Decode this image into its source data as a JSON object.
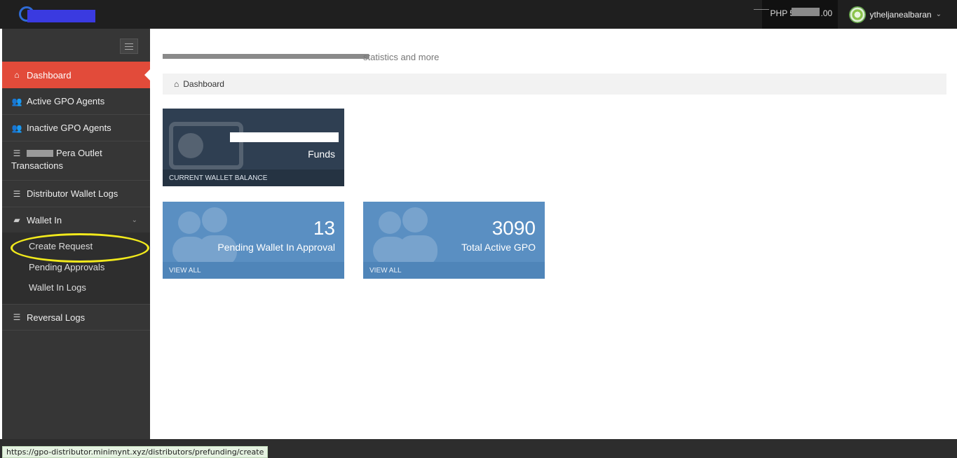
{
  "topbar": {
    "balance_label": "PHP 5",
    "balance_suffix": ".00",
    "username": "ytheljanealbaran",
    "user_chevron": "⌄"
  },
  "sidebar": {
    "items": [
      {
        "label": "Dashboard",
        "icon": "home-icon"
      },
      {
        "label": "Active GPO Agents",
        "icon": "users-icon"
      },
      {
        "label": "Inactive GPO Agents",
        "icon": "users-icon"
      },
      {
        "label_line1": "Pera Outlet",
        "label_line2": "Transactions",
        "icon": "list-icon"
      },
      {
        "label": "Distributor Wallet Logs",
        "icon": "list-icon"
      },
      {
        "label": "Wallet In",
        "icon": "truck-icon"
      },
      {
        "label": "Reversal Logs",
        "icon": "list-icon"
      }
    ],
    "wallet_in_sub": [
      "Create Request",
      "Pending Approvals",
      "Wallet In Logs"
    ]
  },
  "page": {
    "subtitle": "statistics and more",
    "breadcrumb": "Dashboard"
  },
  "tiles": {
    "wallet": {
      "value_suffix": "",
      "label": "Funds",
      "footer": "CURRENT WALLET BALANCE"
    },
    "pending": {
      "value": "13",
      "label": "Pending Wallet In Approval",
      "footer": "VIEW ALL"
    },
    "active": {
      "value": "3090",
      "label": "Total Active GPO",
      "footer": "VIEW ALL"
    }
  },
  "status": {
    "url": "https://gpo-distributor.minimynt.xyz/distributors/prefunding/create"
  }
}
